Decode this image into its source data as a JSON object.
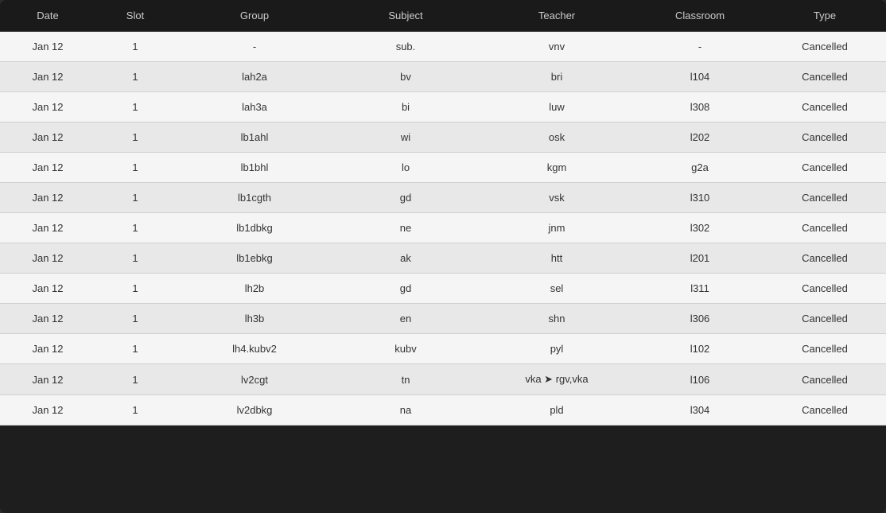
{
  "table": {
    "headers": {
      "date": "Date",
      "slot": "Slot",
      "group": "Group",
      "subject": "Subject",
      "teacher": "Teacher",
      "classroom": "Classroom",
      "type": "Type"
    },
    "rows": [
      {
        "date": "Jan 12",
        "slot": "1",
        "group": "-",
        "subject": "sub.",
        "teacher": "vnv",
        "classroom": "-",
        "type": "Cancelled"
      },
      {
        "date": "Jan 12",
        "slot": "1",
        "group": "lah2a",
        "subject": "bv",
        "teacher": "bri",
        "classroom": "l104",
        "type": "Cancelled"
      },
      {
        "date": "Jan 12",
        "slot": "1",
        "group": "lah3a",
        "subject": "bi",
        "teacher": "luw",
        "classroom": "l308",
        "type": "Cancelled"
      },
      {
        "date": "Jan 12",
        "slot": "1",
        "group": "lb1ahl",
        "subject": "wi",
        "teacher": "osk",
        "classroom": "l202",
        "type": "Cancelled"
      },
      {
        "date": "Jan 12",
        "slot": "1",
        "group": "lb1bhl",
        "subject": "lo",
        "teacher": "kgm",
        "classroom": "g2a",
        "type": "Cancelled"
      },
      {
        "date": "Jan 12",
        "slot": "1",
        "group": "lb1cgth",
        "subject": "gd",
        "teacher": "vsk",
        "classroom": "l310",
        "type": "Cancelled"
      },
      {
        "date": "Jan 12",
        "slot": "1",
        "group": "lb1dbkg",
        "subject": "ne",
        "teacher": "jnm",
        "classroom": "l302",
        "type": "Cancelled"
      },
      {
        "date": "Jan 12",
        "slot": "1",
        "group": "lb1ebkg",
        "subject": "ak",
        "teacher": "htt",
        "classroom": "l201",
        "type": "Cancelled"
      },
      {
        "date": "Jan 12",
        "slot": "1",
        "group": "lh2b",
        "subject": "gd",
        "teacher": "sel",
        "classroom": "l311",
        "type": "Cancelled"
      },
      {
        "date": "Jan 12",
        "slot": "1",
        "group": "lh3b",
        "subject": "en",
        "teacher": "shn",
        "classroom": "l306",
        "type": "Cancelled"
      },
      {
        "date": "Jan 12",
        "slot": "1",
        "group": "lh4.kubv2",
        "subject": "kubv",
        "teacher": "pyl",
        "classroom": "l102",
        "type": "Cancelled"
      },
      {
        "date": "Jan 12",
        "slot": "1",
        "group": "lv2cgt",
        "subject": "tn",
        "teacher": "vka ➤ rgv,vka",
        "classroom": "l106",
        "type": "Cancelled"
      },
      {
        "date": "Jan 12",
        "slot": "1",
        "group": "lv2dbkg",
        "subject": "na",
        "teacher": "pld",
        "classroom": "l304",
        "type": "Cancelled"
      }
    ]
  }
}
